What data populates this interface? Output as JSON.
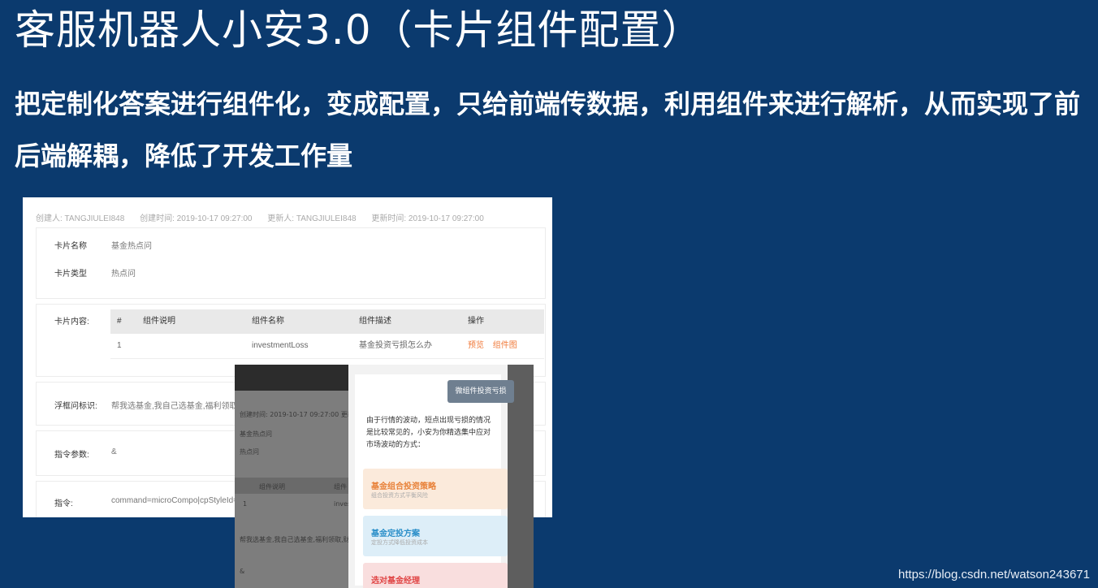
{
  "slide": {
    "title": "客服机器人小安3.0（卡片组件配置）",
    "description": "把定制化答案进行组件化，变成配置，只给前端传数据，利用组件来进行解析，从而实现了前后端解耦，降低了开发工作量",
    "watermark_url": "https://blog.csdn.net/watson243671"
  },
  "card_config": {
    "meta": {
      "creator": "创建人: TANGJIULEI848",
      "created_time": "创建时间: 2019-10-17 09:27:00",
      "updater": "更新人: TANGJIULEI848",
      "updated_time": "更新时间: 2019-10-17 09:27:00"
    },
    "fields": {
      "card_name_label": "卡片名称",
      "card_name_value": "基金热点问",
      "card_type_label": "卡片类型",
      "card_type_value": "热点问",
      "card_content_label": "卡片内容:",
      "float_label": "浮框问标识:",
      "float_value": "帮我选基金,我自己选基金,福利领取,",
      "params_label": "指令参数:",
      "params_value": "&",
      "command_label": "指令:",
      "command_value": "command=microCompo|cpStyleId=2"
    },
    "table": {
      "headers": [
        "#",
        "组件说明",
        "组件名称",
        "组件描述",
        "操作"
      ],
      "rows": [
        {
          "index": "1",
          "desc": "",
          "name": "investmentLoss",
          "detail": "基金投资亏损怎么办",
          "actions": [
            "预览",
            "组件图"
          ]
        }
      ]
    }
  },
  "overlay": {
    "bg_meta": "创建时间: 2019-10-17 09:27:00    更新",
    "bg_name": "基金热点问",
    "bg_type": "热点问",
    "bg_col1": "组件说明",
    "bg_col2": "组件",
    "bg_row": "1",
    "bg_row_name": "inves",
    "bg_float": "帮我选基金,我自己选基金,福利领取,财富体",
    "bg_amp": "&",
    "phone": {
      "button": "微组件投资亏损",
      "message": "由于行情的波动，短点出现亏损的情况是比较常见的，小安为你精选集中应对市场波动的方式：",
      "tiles": [
        {
          "title": "基金组合投资策略",
          "subtitle": "组合投资方式平衡风险",
          "color": "#e8823a",
          "bg": "#fbeadb"
        },
        {
          "title": "基金定投方案",
          "subtitle": "定投方式降低投资成本",
          "color": "#2b8fc9",
          "bg": "#ddeef8"
        },
        {
          "title": "选对基金经理",
          "subtitle": "",
          "color": "#e04545",
          "bg": "#f9dede"
        }
      ]
    }
  }
}
